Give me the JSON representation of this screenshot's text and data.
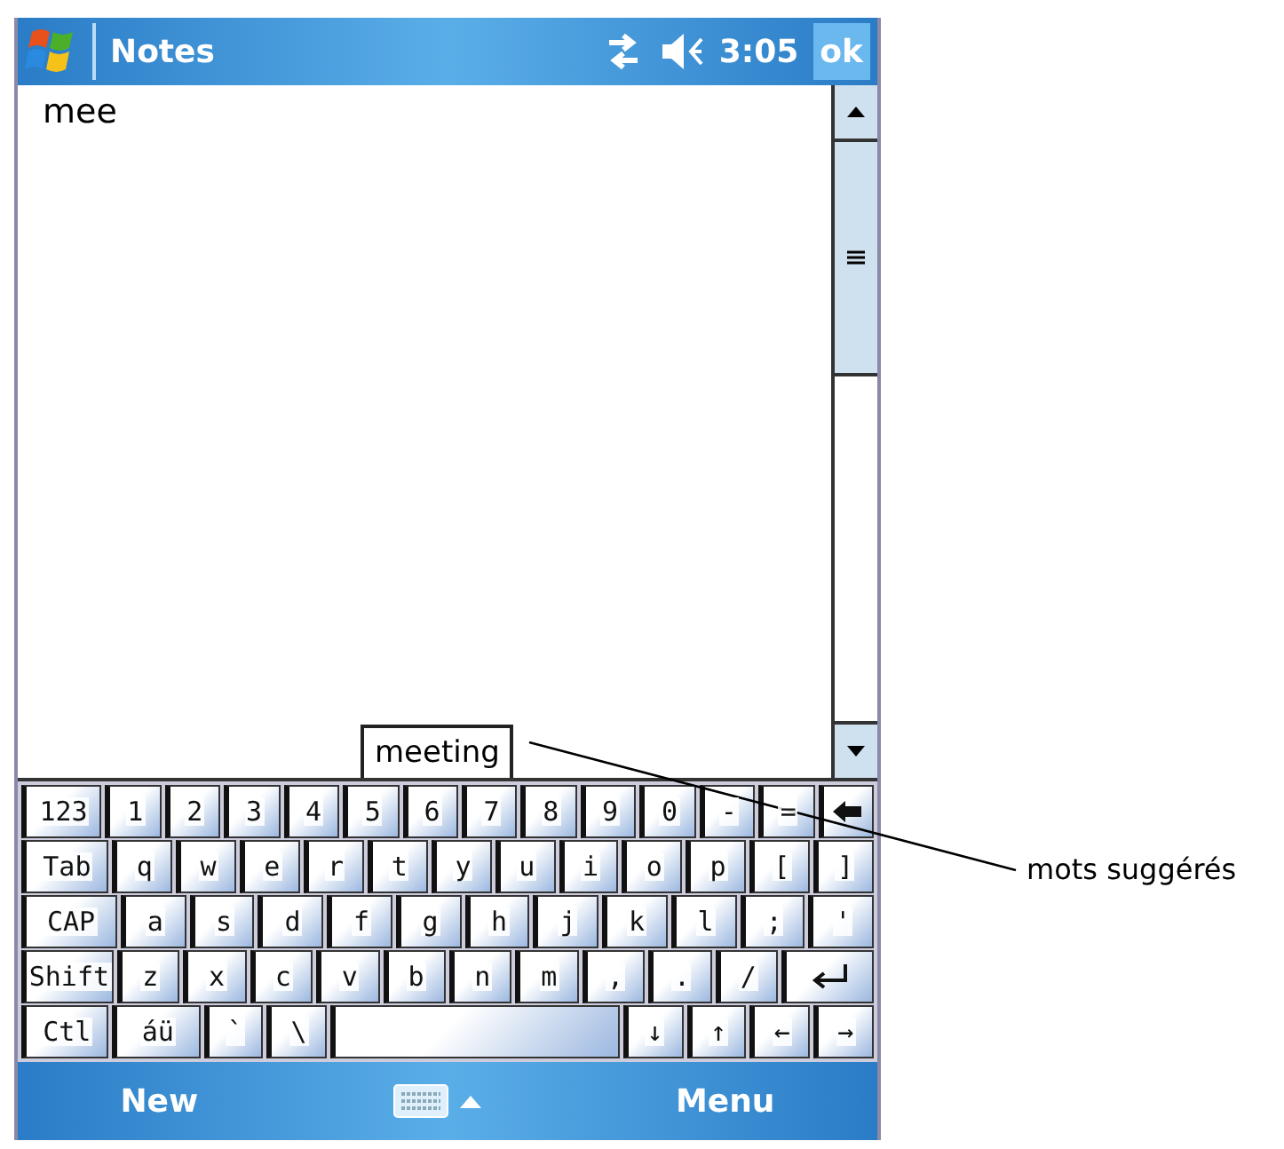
{
  "title_bar": {
    "title": "Notes",
    "time": "3:05",
    "ok": "ok"
  },
  "note": {
    "text": "mee"
  },
  "suggestion": {
    "word": "meeting"
  },
  "keyboard": {
    "rows": [
      {
        "keys": [
          {
            "kind": "key",
            "label": "123"
          },
          {
            "kind": "key",
            "label": "1"
          },
          {
            "kind": "key",
            "label": "2"
          },
          {
            "kind": "key",
            "label": "3"
          },
          {
            "kind": "key",
            "label": "4"
          },
          {
            "kind": "key",
            "label": "5"
          },
          {
            "kind": "key",
            "label": "6"
          },
          {
            "kind": "key",
            "label": "7"
          },
          {
            "kind": "key",
            "label": "8"
          },
          {
            "kind": "key",
            "label": "9"
          },
          {
            "kind": "key",
            "label": "0"
          },
          {
            "kind": "key",
            "label": "-"
          },
          {
            "kind": "key",
            "label": "="
          },
          {
            "kind": "backspace"
          }
        ]
      },
      {
        "keys": [
          {
            "kind": "key",
            "label": "Tab"
          },
          {
            "kind": "key",
            "label": "q"
          },
          {
            "kind": "key",
            "label": "w"
          },
          {
            "kind": "key",
            "label": "e"
          },
          {
            "kind": "key",
            "label": "r"
          },
          {
            "kind": "key",
            "label": "t"
          },
          {
            "kind": "key",
            "label": "y"
          },
          {
            "kind": "key",
            "label": "u"
          },
          {
            "kind": "key",
            "label": "i"
          },
          {
            "kind": "key",
            "label": "o"
          },
          {
            "kind": "key",
            "label": "p"
          },
          {
            "kind": "key",
            "label": "["
          },
          {
            "kind": "key",
            "label": "]"
          }
        ]
      },
      {
        "keys": [
          {
            "kind": "key",
            "label": "CAP"
          },
          {
            "kind": "key",
            "label": "a"
          },
          {
            "kind": "key",
            "label": "s"
          },
          {
            "kind": "key",
            "label": "d"
          },
          {
            "kind": "key",
            "label": "f"
          },
          {
            "kind": "key",
            "label": "g"
          },
          {
            "kind": "key",
            "label": "h"
          },
          {
            "kind": "key",
            "label": "j"
          },
          {
            "kind": "key",
            "label": "k"
          },
          {
            "kind": "key",
            "label": "l"
          },
          {
            "kind": "key",
            "label": ";"
          },
          {
            "kind": "key",
            "label": "'"
          }
        ]
      },
      {
        "keys": [
          {
            "kind": "key",
            "label": "Shift"
          },
          {
            "kind": "key",
            "label": "z"
          },
          {
            "kind": "key",
            "label": "x"
          },
          {
            "kind": "key",
            "label": "c"
          },
          {
            "kind": "key",
            "label": "v"
          },
          {
            "kind": "key",
            "label": "b"
          },
          {
            "kind": "key",
            "label": "n"
          },
          {
            "kind": "key",
            "label": "m"
          },
          {
            "kind": "key",
            "label": ","
          },
          {
            "kind": "key",
            "label": "."
          },
          {
            "kind": "key",
            "label": "/"
          },
          {
            "kind": "enter"
          }
        ]
      },
      {
        "keys": [
          {
            "kind": "key",
            "label": "Ctl"
          },
          {
            "kind": "key",
            "label": "áü"
          },
          {
            "kind": "key",
            "label": "`"
          },
          {
            "kind": "key",
            "label": "\\"
          },
          {
            "kind": "space"
          },
          {
            "kind": "key",
            "label": "↓"
          },
          {
            "kind": "key",
            "label": "↑"
          },
          {
            "kind": "key",
            "label": "←"
          },
          {
            "kind": "key",
            "label": "→"
          }
        ]
      }
    ]
  },
  "menu_bar": {
    "left": "New",
    "right": "Menu"
  },
  "callout": {
    "label": "mots suggérés"
  }
}
